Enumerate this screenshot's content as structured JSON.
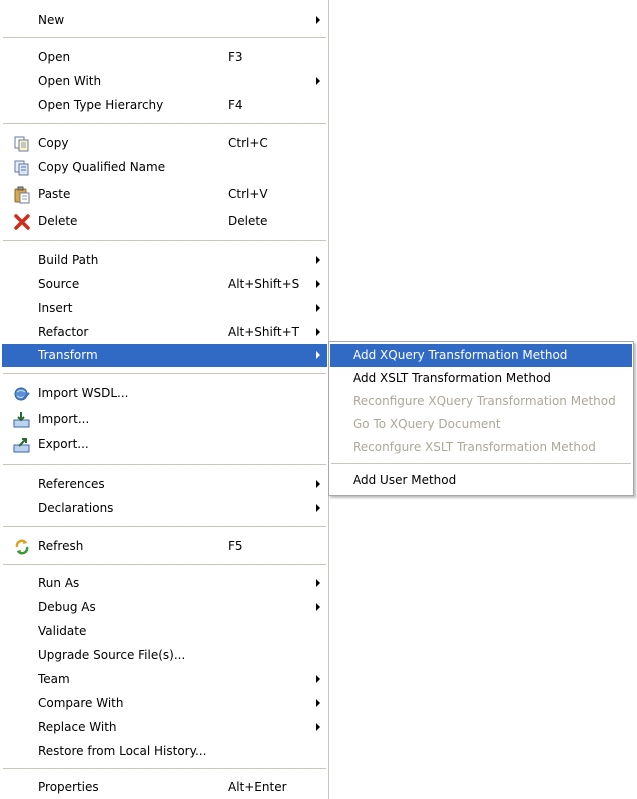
{
  "context_menu": {
    "new": {
      "label": "New"
    },
    "open": {
      "label": "Open",
      "shortcut": "F3"
    },
    "open_with": {
      "label": "Open With"
    },
    "open_type_hierarchy": {
      "label": "Open Type Hierarchy",
      "shortcut": "F4"
    },
    "copy": {
      "label": "Copy",
      "shortcut": "Ctrl+C",
      "icon": "copy-icon"
    },
    "copy_qualified_name": {
      "label": "Copy Qualified Name",
      "icon": "copy-qualified-name-icon"
    },
    "paste": {
      "label": "Paste",
      "shortcut": "Ctrl+V",
      "icon": "paste-icon"
    },
    "delete": {
      "label": "Delete",
      "shortcut": "Delete",
      "icon": "delete-icon"
    },
    "build_path": {
      "label": "Build Path"
    },
    "source": {
      "label": "Source",
      "shortcut": "Alt+Shift+S"
    },
    "insert": {
      "label": "Insert"
    },
    "refactor": {
      "label": "Refactor",
      "shortcut": "Alt+Shift+T"
    },
    "transform": {
      "label": "Transform"
    },
    "import_wsdl": {
      "label": "Import WSDL...",
      "icon": "import-wsdl-icon"
    },
    "import": {
      "label": "Import...",
      "icon": "import-icon"
    },
    "export": {
      "label": "Export...",
      "icon": "export-icon"
    },
    "references": {
      "label": "References"
    },
    "declarations": {
      "label": "Declarations"
    },
    "refresh": {
      "label": "Refresh",
      "shortcut": "F5",
      "icon": "refresh-icon"
    },
    "run_as": {
      "label": "Run As"
    },
    "debug_as": {
      "label": "Debug As"
    },
    "validate": {
      "label": "Validate"
    },
    "upgrade_source": {
      "label": "Upgrade Source File(s)..."
    },
    "team": {
      "label": "Team"
    },
    "compare_with": {
      "label": "Compare With"
    },
    "replace_with": {
      "label": "Replace With"
    },
    "restore_history": {
      "label": "Restore from Local History..."
    },
    "properties": {
      "label": "Properties",
      "shortcut": "Alt+Enter"
    }
  },
  "transform_submenu": {
    "add_xquery": {
      "label": "Add XQuery Transformation Method"
    },
    "add_xslt": {
      "label": "Add XSLT Transformation Method"
    },
    "reconfigure_xquery": {
      "label": "Reconfigure XQuery Transformation Method"
    },
    "go_to_xquery": {
      "label": "Go To XQuery Document"
    },
    "reconfigure_xslt": {
      "label": "Reconfgure XSLT Transformation Method"
    },
    "add_user_method": {
      "label": "Add User Method"
    }
  },
  "colors": {
    "highlight": "#316ac5",
    "disabled_text": "#aca899",
    "separator": "#c9c7ba"
  }
}
